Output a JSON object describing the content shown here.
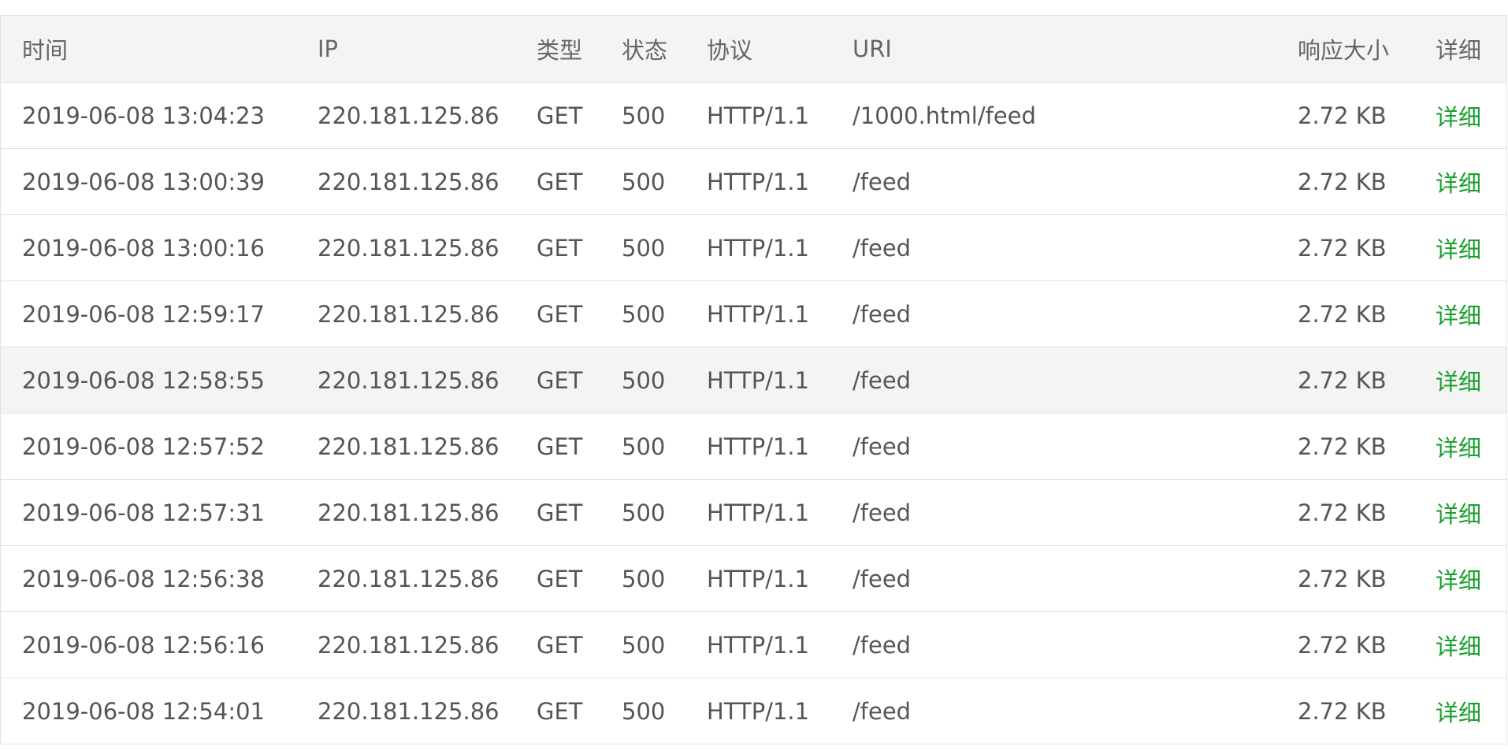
{
  "table": {
    "headers": {
      "time": "时间",
      "ip": "IP",
      "method": "类型",
      "status": "状态",
      "protocol": "协议",
      "uri": "URI",
      "size": "响应大小",
      "detail": "详细"
    },
    "rows": [
      {
        "time": "2019-06-08 13:04:23",
        "ip": "220.181.125.86",
        "method": "GET",
        "status": "500",
        "protocol": "HTTP/1.1",
        "uri": "/1000.html/feed",
        "size": "2.72 KB",
        "detail": "详细"
      },
      {
        "time": "2019-06-08 13:00:39",
        "ip": "220.181.125.86",
        "method": "GET",
        "status": "500",
        "protocol": "HTTP/1.1",
        "uri": "/feed",
        "size": "2.72 KB",
        "detail": "详细"
      },
      {
        "time": "2019-06-08 13:00:16",
        "ip": "220.181.125.86",
        "method": "GET",
        "status": "500",
        "protocol": "HTTP/1.1",
        "uri": "/feed",
        "size": "2.72 KB",
        "detail": "详细"
      },
      {
        "time": "2019-06-08 12:59:17",
        "ip": "220.181.125.86",
        "method": "GET",
        "status": "500",
        "protocol": "HTTP/1.1",
        "uri": "/feed",
        "size": "2.72 KB",
        "detail": "详细"
      },
      {
        "time": "2019-06-08 12:58:55",
        "ip": "220.181.125.86",
        "method": "GET",
        "status": "500",
        "protocol": "HTTP/1.1",
        "uri": "/feed",
        "size": "2.72 KB",
        "detail": "详细"
      },
      {
        "time": "2019-06-08 12:57:52",
        "ip": "220.181.125.86",
        "method": "GET",
        "status": "500",
        "protocol": "HTTP/1.1",
        "uri": "/feed",
        "size": "2.72 KB",
        "detail": "详细"
      },
      {
        "time": "2019-06-08 12:57:31",
        "ip": "220.181.125.86",
        "method": "GET",
        "status": "500",
        "protocol": "HTTP/1.1",
        "uri": "/feed",
        "size": "2.72 KB",
        "detail": "详细"
      },
      {
        "time": "2019-06-08 12:56:38",
        "ip": "220.181.125.86",
        "method": "GET",
        "status": "500",
        "protocol": "HTTP/1.1",
        "uri": "/feed",
        "size": "2.72 KB",
        "detail": "详细"
      },
      {
        "time": "2019-06-08 12:56:16",
        "ip": "220.181.125.86",
        "method": "GET",
        "status": "500",
        "protocol": "HTTP/1.1",
        "uri": "/feed",
        "size": "2.72 KB",
        "detail": "详细"
      },
      {
        "time": "2019-06-08 12:54:01",
        "ip": "220.181.125.86",
        "method": "GET",
        "status": "500",
        "protocol": "HTTP/1.1",
        "uri": "/feed",
        "size": "2.72 KB",
        "detail": "详细"
      }
    ]
  },
  "colors": {
    "link": "#1aa02e",
    "header_bg": "#f4f4f4",
    "border": "#e2e2e2",
    "text": "#555555"
  }
}
